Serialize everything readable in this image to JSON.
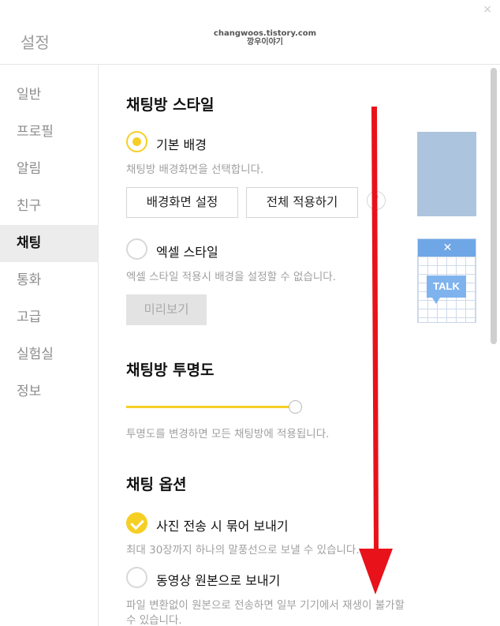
{
  "window": {
    "title": "설정",
    "watermark_line1": "changwoos.tistory.com",
    "watermark_line2": "깡우이야기",
    "close_glyph": "×"
  },
  "sidebar": {
    "items": [
      {
        "label": "일반"
      },
      {
        "label": "프로필"
      },
      {
        "label": "알림"
      },
      {
        "label": "친구"
      },
      {
        "label": "채팅",
        "active": true
      },
      {
        "label": "통화"
      },
      {
        "label": "고급"
      },
      {
        "label": "실험실"
      },
      {
        "label": "정보"
      }
    ]
  },
  "style_section": {
    "title": "채팅방 스타일",
    "basic_label": "기본 배경",
    "basic_selected": true,
    "basic_desc": "채팅방 배경화면을 선택합니다.",
    "set_bg_button": "배경화면 설정",
    "apply_all_button": "전체 적용하기",
    "help_glyph": "?",
    "excel_label": "엑셀 스타일",
    "excel_selected": false,
    "excel_desc": "엑셀 스타일 적용시 배경을 설정할 수 없습니다.",
    "preview_button": "미리보기",
    "excel_preview_x": "✕",
    "excel_preview_talk": "TALK"
  },
  "opacity_section": {
    "title": "채팅방 투명도",
    "slider_value": 1.0,
    "desc": "투명도를 변경하면 모든 채팅방에 적용됩니다."
  },
  "options_section": {
    "title": "채팅 옵션",
    "photo_label": "사진 전송 시 묶어 보내기",
    "photo_checked": true,
    "photo_desc": "최대 30장까지 하나의 말풍선으로 보낼 수 있습니다.",
    "video_label": "동영상 원본으로 보내기",
    "video_checked": false,
    "video_desc_line1": "파일 변환없이 원본으로 전송하면 일부 기기에서 재생이 불가할",
    "video_desc_line2": "수 있습니다."
  },
  "colors": {
    "accent": "#f6cf24",
    "arrow": "#e8121a",
    "preview_bg": "#adc4de"
  },
  "icons": {
    "close": "close-icon",
    "help": "help-icon",
    "check": "check-icon",
    "arrow": "down-arrow-annotation"
  }
}
